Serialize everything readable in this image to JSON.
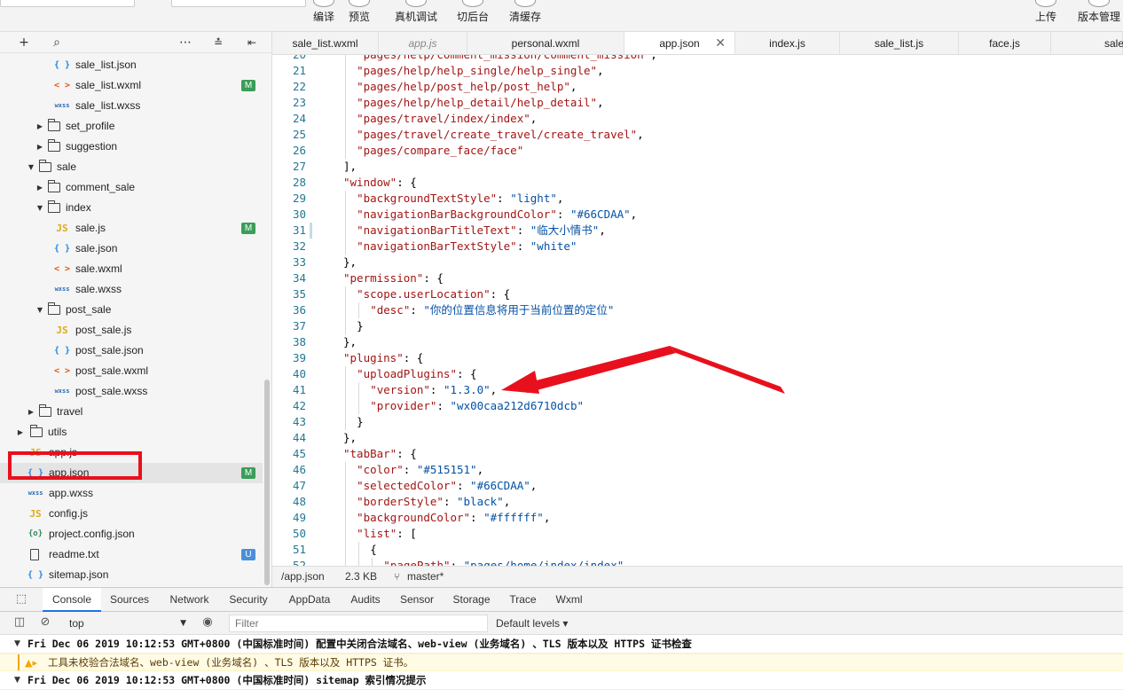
{
  "toolbar": {
    "buttons": [
      {
        "label": "编译"
      },
      {
        "label": "预览"
      },
      {
        "label": "真机调试"
      },
      {
        "label": "切后台"
      },
      {
        "label": "清缓存"
      },
      {
        "label": "上传"
      },
      {
        "label": "版本管理"
      }
    ]
  },
  "sidebar": {
    "tree": [
      {
        "name": "sale_list.json",
        "type": "json",
        "depth": 3
      },
      {
        "name": "sale_list.wxml",
        "type": "wxml",
        "depth": 3,
        "badge": "M"
      },
      {
        "name": "sale_list.wxss",
        "type": "wxss",
        "depth": 3
      },
      {
        "name": "set_profile",
        "type": "folder",
        "depth": 2,
        "expanded": false
      },
      {
        "name": "suggestion",
        "type": "folder",
        "depth": 2,
        "expanded": false
      },
      {
        "name": "sale",
        "type": "folder",
        "depth": 1,
        "expanded": true
      },
      {
        "name": "comment_sale",
        "type": "folder",
        "depth": 2,
        "expanded": false
      },
      {
        "name": "index",
        "type": "folder",
        "depth": 2,
        "expanded": true
      },
      {
        "name": "sale.js",
        "type": "js",
        "depth": 3,
        "badge": "M"
      },
      {
        "name": "sale.json",
        "type": "json",
        "depth": 3
      },
      {
        "name": "sale.wxml",
        "type": "wxml",
        "depth": 3
      },
      {
        "name": "sale.wxss",
        "type": "wxss",
        "depth": 3
      },
      {
        "name": "post_sale",
        "type": "folder",
        "depth": 2,
        "expanded": true
      },
      {
        "name": "post_sale.js",
        "type": "js",
        "depth": 3
      },
      {
        "name": "post_sale.json",
        "type": "json",
        "depth": 3
      },
      {
        "name": "post_sale.wxml",
        "type": "wxml",
        "depth": 3
      },
      {
        "name": "post_sale.wxss",
        "type": "wxss",
        "depth": 3
      },
      {
        "name": "travel",
        "type": "folder",
        "depth": 1,
        "expanded": false
      },
      {
        "name": "utils",
        "type": "folder",
        "depth": 0,
        "expanded": false
      },
      {
        "name": "app.js",
        "type": "js",
        "depth": 0
      },
      {
        "name": "app.json",
        "type": "json",
        "depth": 0,
        "badge": "M",
        "selected": true
      },
      {
        "name": "app.wxss",
        "type": "wxss",
        "depth": 0
      },
      {
        "name": "config.js",
        "type": "js",
        "depth": 0
      },
      {
        "name": "project.config.json",
        "type": "cfg",
        "depth": 0
      },
      {
        "name": "readme.txt",
        "type": "txt",
        "depth": 0,
        "badge": "U"
      },
      {
        "name": "sitemap.json",
        "type": "json",
        "depth": 0
      }
    ]
  },
  "icons": {
    "js": "JS",
    "json": "{ }",
    "wxml": "< >",
    "wxss": "wxss",
    "cfg": "{o}",
    "txt": ""
  },
  "colors": {
    "badge_m": "#3a9e58",
    "badge_u": "#4a90d9",
    "highlight": "#e8101c"
  },
  "tabs": [
    {
      "label": "sale_list.wxml"
    },
    {
      "label": "app.js",
      "italic": true
    },
    {
      "label": "personal.wxml"
    },
    {
      "label": "app.json",
      "active": true,
      "closable": true
    },
    {
      "label": "index.js"
    },
    {
      "label": "sale_list.js"
    },
    {
      "label": "face.js"
    },
    {
      "label": "sale"
    }
  ],
  "editor": {
    "lines": [
      {
        "n": "20",
        "ind": 1,
        "t": [
          [
            "k",
            "\"pages/help/comment_mission/comment_mission\""
          ],
          [
            "p",
            ","
          ]
        ]
      },
      {
        "n": "21",
        "ind": 1,
        "t": [
          [
            "k",
            "\"pages/help/help_single/help_single\""
          ],
          [
            "p",
            ","
          ]
        ]
      },
      {
        "n": "22",
        "ind": 1,
        "t": [
          [
            "k",
            "\"pages/help/post_help/post_help\""
          ],
          [
            "p",
            ","
          ]
        ]
      },
      {
        "n": "23",
        "ind": 1,
        "t": [
          [
            "k",
            "\"pages/help/help_detail/help_detail\""
          ],
          [
            "p",
            ","
          ]
        ]
      },
      {
        "n": "24",
        "ind": 1,
        "t": [
          [
            "k",
            "\"pages/travel/index/index\""
          ],
          [
            "p",
            ","
          ]
        ]
      },
      {
        "n": "25",
        "ind": 1,
        "t": [
          [
            "k",
            "\"pages/travel/create_travel/create_travel\""
          ],
          [
            "p",
            ","
          ]
        ]
      },
      {
        "n": "26",
        "ind": 1,
        "t": [
          [
            "k",
            "\"pages/compare_face/face\""
          ]
        ]
      },
      {
        "n": "27",
        "ind": 0,
        "t": [
          [
            "p",
            "],"
          ]
        ]
      },
      {
        "n": "28",
        "ind": 0,
        "t": [
          [
            "k",
            "\"window\""
          ],
          [
            "p",
            ": {"
          ]
        ]
      },
      {
        "n": "29",
        "ind": 1,
        "t": [
          [
            "k",
            "\"backgroundTextStyle\""
          ],
          [
            "p",
            ": "
          ],
          [
            "v",
            "\"light\""
          ],
          [
            "p",
            ","
          ]
        ]
      },
      {
        "n": "30",
        "ind": 1,
        "t": [
          [
            "k",
            "\"navigationBarBackgroundColor\""
          ],
          [
            "p",
            ": "
          ],
          [
            "v",
            "\"#66CDAA\""
          ],
          [
            "p",
            ","
          ]
        ]
      },
      {
        "n": "31",
        "ind": 1,
        "t": [
          [
            "k",
            "\"navigationBarTitleText\""
          ],
          [
            "p",
            ": "
          ],
          [
            "v",
            "\"临大小情书\""
          ],
          [
            "p",
            ","
          ]
        ]
      },
      {
        "n": "32",
        "ind": 1,
        "t": [
          [
            "k",
            "\"navigationBarTextStyle\""
          ],
          [
            "p",
            ": "
          ],
          [
            "v",
            "\"white\""
          ]
        ]
      },
      {
        "n": "33",
        "ind": 0,
        "t": [
          [
            "p",
            "},"
          ]
        ]
      },
      {
        "n": "34",
        "ind": 0,
        "t": [
          [
            "k",
            "\"permission\""
          ],
          [
            "p",
            ": {"
          ]
        ]
      },
      {
        "n": "35",
        "ind": 1,
        "t": [
          [
            "k",
            "\"scope.userLocation\""
          ],
          [
            "p",
            ": {"
          ]
        ]
      },
      {
        "n": "36",
        "ind": 2,
        "t": [
          [
            "k",
            "\"desc\""
          ],
          [
            "p",
            ": "
          ],
          [
            "v",
            "\"你的位置信息将用于当前位置的定位\""
          ]
        ]
      },
      {
        "n": "37",
        "ind": 1,
        "t": [
          [
            "p",
            "}"
          ]
        ]
      },
      {
        "n": "38",
        "ind": 0,
        "t": [
          [
            "p",
            "},"
          ]
        ]
      },
      {
        "n": "39",
        "ind": 0,
        "t": [
          [
            "k",
            "\"plugins\""
          ],
          [
            "p",
            ": {"
          ]
        ]
      },
      {
        "n": "40",
        "ind": 1,
        "t": [
          [
            "k",
            "\"uploadPlugins\""
          ],
          [
            "p",
            ": {"
          ]
        ]
      },
      {
        "n": "41",
        "ind": 2,
        "t": [
          [
            "k",
            "\"version\""
          ],
          [
            "p",
            ": "
          ],
          [
            "v",
            "\"1.3.0\""
          ],
          [
            "p",
            ","
          ]
        ]
      },
      {
        "n": "42",
        "ind": 2,
        "t": [
          [
            "k",
            "\"provider\""
          ],
          [
            "p",
            ": "
          ],
          [
            "v",
            "\"wx00caa212d6710dcb\""
          ]
        ]
      },
      {
        "n": "43",
        "ind": 1,
        "t": [
          [
            "p",
            "}"
          ]
        ]
      },
      {
        "n": "44",
        "ind": 0,
        "t": [
          [
            "p",
            "},"
          ]
        ]
      },
      {
        "n": "45",
        "ind": 0,
        "t": [
          [
            "k",
            "\"tabBar\""
          ],
          [
            "p",
            ": {"
          ]
        ]
      },
      {
        "n": "46",
        "ind": 1,
        "t": [
          [
            "k",
            "\"color\""
          ],
          [
            "p",
            ": "
          ],
          [
            "v",
            "\"#515151\""
          ],
          [
            "p",
            ","
          ]
        ]
      },
      {
        "n": "47",
        "ind": 1,
        "t": [
          [
            "k",
            "\"selectedColor\""
          ],
          [
            "p",
            ": "
          ],
          [
            "v",
            "\"#66CDAA\""
          ],
          [
            "p",
            ","
          ]
        ]
      },
      {
        "n": "48",
        "ind": 1,
        "t": [
          [
            "k",
            "\"borderStyle\""
          ],
          [
            "p",
            ": "
          ],
          [
            "v",
            "\"black\""
          ],
          [
            "p",
            ","
          ]
        ]
      },
      {
        "n": "49",
        "ind": 1,
        "t": [
          [
            "k",
            "\"backgroundColor\""
          ],
          [
            "p",
            ": "
          ],
          [
            "v",
            "\"#ffffff\""
          ],
          [
            "p",
            ","
          ]
        ]
      },
      {
        "n": "50",
        "ind": 1,
        "t": [
          [
            "k",
            "\"list\""
          ],
          [
            "p",
            ": ["
          ]
        ]
      },
      {
        "n": "51",
        "ind": 2,
        "t": [
          [
            "p",
            "{"
          ]
        ]
      },
      {
        "n": "52",
        "ind": 3,
        "t": [
          [
            "k",
            "\"pagePath\""
          ],
          [
            "p",
            ": "
          ],
          [
            "v",
            "\"pages/home/index/index\""
          ],
          [
            "p",
            ","
          ]
        ]
      }
    ]
  },
  "statusbar": {
    "path": "/app.json",
    "size": "2.3 KB",
    "branch": "master*"
  },
  "devtools": {
    "tabs": [
      "Console",
      "Sources",
      "Network",
      "Security",
      "AppData",
      "Audits",
      "Sensor",
      "Storage",
      "Trace",
      "Wxml"
    ],
    "active_tab": "Console",
    "context": "top",
    "filter_placeholder": "Filter",
    "levels": "Default levels ▾",
    "logs": [
      {
        "kind": "info",
        "text": "Fri Dec 06 2019 10:12:53 GMT+0800 (中国标准时间) 配置中关闭合法域名、web-view (业务域名) 、TLS 版本以及 HTTPS 证书检查"
      },
      {
        "kind": "warn",
        "text": "工具未校验合法域名、web-view (业务域名) 、TLS 版本以及 HTTPS 证书。"
      },
      {
        "kind": "info",
        "text": "Fri Dec 06 2019 10:12:53 GMT+0800 (中国标准时间) sitemap 索引情况提示"
      }
    ]
  }
}
